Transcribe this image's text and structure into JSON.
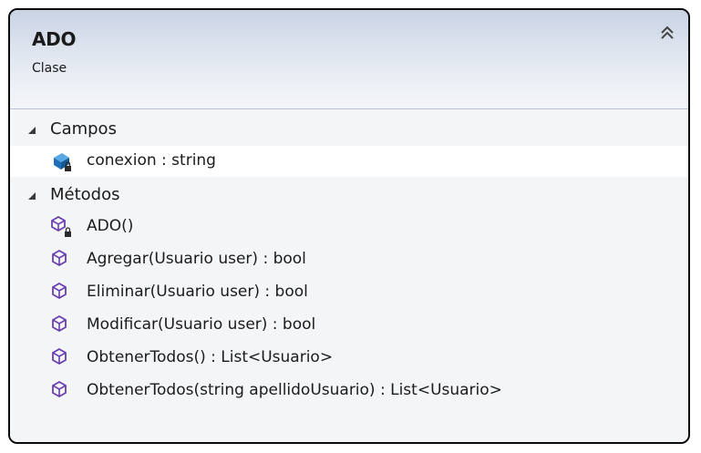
{
  "class": {
    "name": "ADO",
    "kind": "Clase"
  },
  "sections": {
    "fields": {
      "label": "Campos",
      "items": [
        {
          "signature": "conexion : string",
          "icon": "private-field-icon"
        }
      ]
    },
    "methods": {
      "label": "Métodos",
      "items": [
        {
          "signature": "ADO()",
          "icon": "private-method-icon"
        },
        {
          "signature": "Agregar(Usuario user) : bool",
          "icon": "public-method-icon"
        },
        {
          "signature": "Eliminar(Usuario user) : bool",
          "icon": "public-method-icon"
        },
        {
          "signature": "Modificar(Usuario user) : bool",
          "icon": "public-method-icon"
        },
        {
          "signature": "ObtenerTodos() : List<Usuario>",
          "icon": "public-method-icon"
        },
        {
          "signature": "ObtenerTodos(string apellidoUsuario) : List<Usuario>",
          "icon": "public-method-icon"
        }
      ]
    }
  },
  "colors": {
    "method_icon": "#6a3fb0",
    "field_icon": "#1f6fb8",
    "header_gradient_top": "#c9d3e4"
  }
}
